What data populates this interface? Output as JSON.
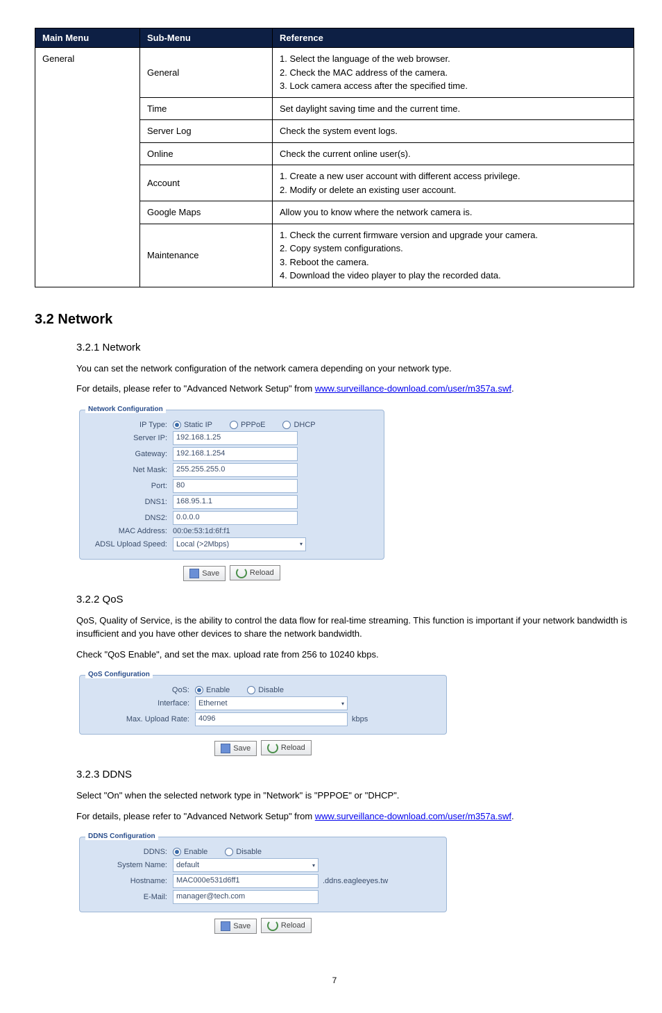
{
  "table": {
    "headers": [
      "Main Menu",
      "Sub-Menu",
      "Reference"
    ],
    "rows": [
      {
        "main": "General",
        "sub": "General",
        "ref": "1. Select the language of the web browser.\n2. Check the MAC address of the camera.\n3. Lock camera access after the specified time."
      },
      {
        "main": "",
        "sub": "Time",
        "ref": "Set daylight saving time and the current time."
      },
      {
        "main": "",
        "sub": "Server Log",
        "ref": "Check the system event logs."
      },
      {
        "main": "",
        "sub": "Online",
        "ref": "Check the current online user(s)."
      },
      {
        "main": "",
        "sub": "Account",
        "ref": "1. Create a new user account with different access privilege.\n2. Modify or delete an existing user account."
      },
      {
        "main": "",
        "sub": "Google Maps",
        "ref": "Allow you to know where the network camera is."
      },
      {
        "main": "",
        "sub": "Maintenance",
        "ref": "1. Check the current firmware version and upgrade your camera.\n2. Copy system configurations.\n3. Reboot the camera.\n4. Download the video player to play the recorded data."
      }
    ]
  },
  "section": {
    "num": "3.2",
    "title": "Network"
  },
  "s321": {
    "heading": "3.2.1 Network",
    "p1": "You can set the network configuration of the network camera depending on your network type.",
    "p2a": "For details, please refer to \"Advanced Network Setup\" from ",
    "link": "www.surveillance-download.com/user/m357a.swf",
    "period": ".",
    "panel_title": "Network Configuration",
    "labels": {
      "ip_type": "IP Type:",
      "static": "Static IP",
      "pppoe": "PPPoE",
      "dhcp": "DHCP",
      "server_ip": "Server IP:",
      "gateway": "Gateway:",
      "netmask": "Net Mask:",
      "port": "Port:",
      "dns1": "DNS1:",
      "dns2": "DNS2:",
      "mac": "MAC Address:",
      "adsl": "ADSL Upload Speed:"
    },
    "values": {
      "server_ip": "192.168.1.25",
      "gateway": "192.168.1.254",
      "netmask": "255.255.255.0",
      "port": "80",
      "dns1": "168.95.1.1",
      "dns2": "0.0.0.0",
      "mac": "00:0e:53:1d:6f:f1",
      "adsl": "Local (>2Mbps)"
    }
  },
  "s322": {
    "heading": "3.2.2 QoS",
    "p1": "QoS, Quality of Service, is the ability to control the data flow for real-time streaming. This function is important if your network bandwidth is insufficient and you have other devices to share the network bandwidth.",
    "p2": "Check \"QoS Enable\", and set the max. upload rate from 256 to 10240 kbps.",
    "panel_title": "QoS Configuration",
    "labels": {
      "qos": "QoS:",
      "enable": "Enable",
      "disable": "Disable",
      "interface": "Interface:",
      "max": "Max. Upload Rate:",
      "kbps": "kbps"
    },
    "values": {
      "interface": "Ethernet",
      "max": "4096"
    }
  },
  "s323": {
    "heading": "3.2.3 DDNS",
    "p1": "Select \"On\" when the selected network type in \"Network\" is \"PPPOE\" or \"DHCP\".",
    "p2a": "For details, please refer to \"Advanced Network Setup\" from ",
    "link": "www.surveillance-download.com/user/m357a.swf",
    "period": ".",
    "panel_title": "DDNS Configuration",
    "labels": {
      "ddns": "DDNS:",
      "enable": "Enable",
      "disable": "Disable",
      "system": "System Name:",
      "hostname": "Hostname:",
      "email": "E-Mail:"
    },
    "values": {
      "system": "default",
      "hostname": "MAC000e531d6ff1",
      "suffix": ".ddns.eagleeyes.tw",
      "email": "manager@tech.com"
    }
  },
  "buttons": {
    "save": "Save",
    "reload": "Reload"
  },
  "page": "7"
}
